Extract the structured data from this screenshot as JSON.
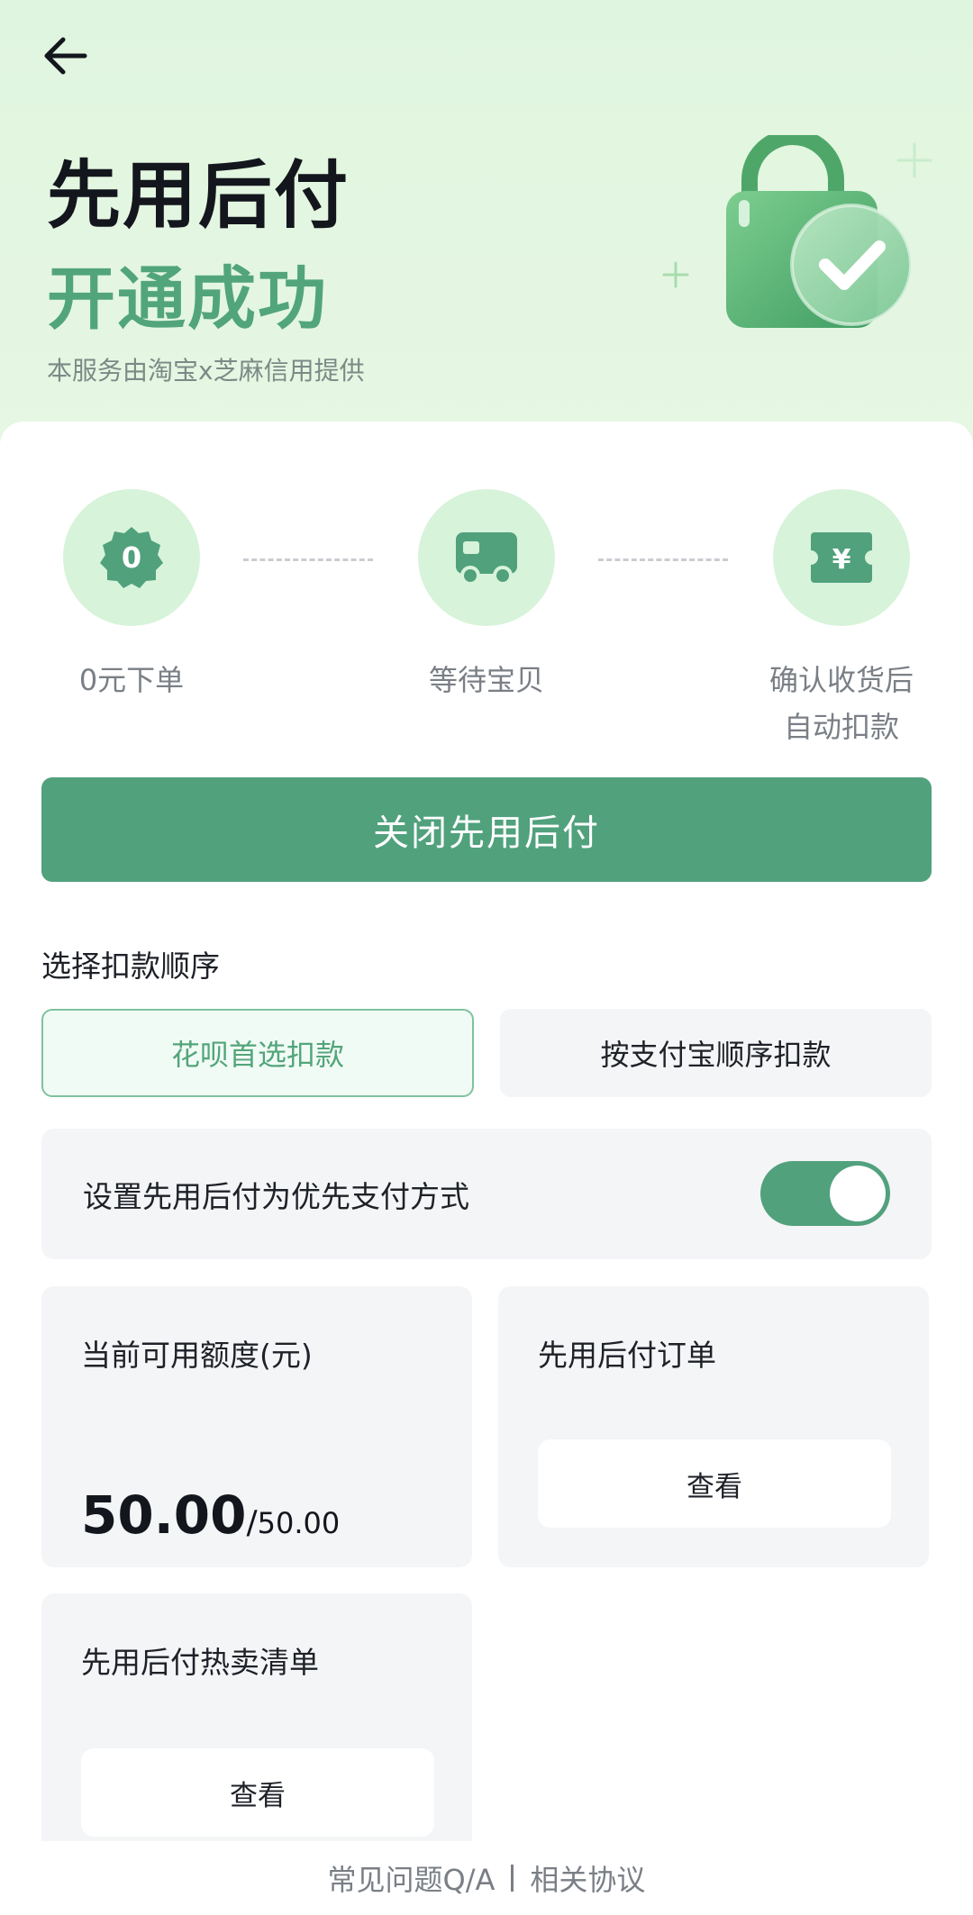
{
  "hero": {
    "title": "先用后付",
    "subtitle": "开通成功",
    "provider": "本服务由淘宝x芝麻信用提供"
  },
  "steps": [
    {
      "label": "0元下单",
      "icon": "zero-badge-icon",
      "badge_text": "0"
    },
    {
      "label": "等待宝贝",
      "icon": "truck-icon"
    },
    {
      "label_line1": "确认收货后",
      "label_line2": "自动扣款",
      "icon": "yuan-ticket-icon",
      "badge_text": "¥"
    }
  ],
  "close_button": "关闭先用后付",
  "deduction": {
    "section_label": "选择扣款顺序",
    "options": [
      "花呗首选扣款",
      "按支付宝顺序扣款"
    ],
    "selected": "花呗首选扣款"
  },
  "priority_toggle": {
    "label": "设置先用后付为优先支付方式",
    "on": true
  },
  "credit": {
    "title": "当前可用额度(元)",
    "available": "50.00",
    "separator": "/",
    "total": "50.00"
  },
  "orders": {
    "title": "先用后付订单",
    "button": "查看"
  },
  "hot_list": {
    "title": "先用后付热卖清单",
    "button": "查看"
  },
  "footer": {
    "faq": "常见问题Q/A",
    "agreement": "相关协议"
  },
  "colors": {
    "accent": "#51a17d",
    "hero_bg": "#e0f5df",
    "step_circle": "#d7f3d9",
    "tile_bg": "#f4f5f7"
  }
}
